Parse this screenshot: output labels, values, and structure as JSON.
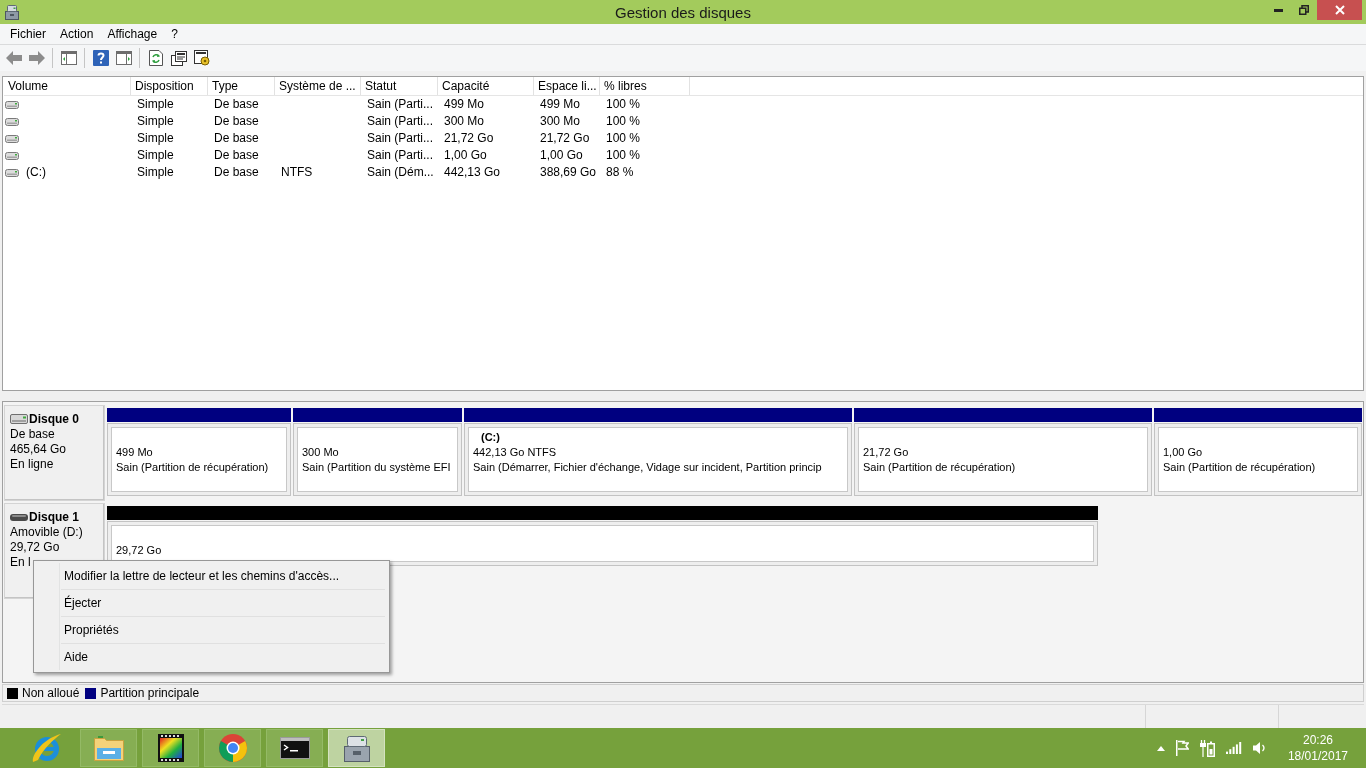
{
  "window": {
    "title": "Gestion des disques"
  },
  "menu_bar": [
    "Fichier",
    "Action",
    "Affichage",
    "?"
  ],
  "table": {
    "columns": [
      "Volume",
      "Disposition",
      "Type",
      "Système de ...",
      "Statut",
      "Capacité",
      "Espace li...",
      "% libres"
    ],
    "rows": [
      {
        "disposition": "Simple",
        "type": "De base",
        "status": "Sain (Parti...",
        "capacity": "499 Mo",
        "column_7": "499 Mo",
        "percent_free": "100 %"
      },
      {
        "disposition": "Simple",
        "type": "De base",
        "status": "Sain (Parti...",
        "capacity": "300 Mo",
        "column_7": "300 Mo",
        "percent_free": "100 %"
      },
      {
        "disposition": "Simple",
        "type": "De base",
        "status": "Sain (Parti...",
        "capacity": "21,72 Go",
        "column_7": "21,72 Go",
        "percent_free": "100 %"
      },
      {
        "disposition": "Simple",
        "type": "De base",
        "status": "Sain (Parti...",
        "capacity": "1,00 Go",
        "column_7": "1,00 Go",
        "percent_free": "100 %"
      },
      {
        "volume": "(C:)",
        "disposition": "Simple",
        "type": "De base",
        "column_4": "NTFS",
        "status": "Sain (Dém...",
        "capacity": "442,13 Go",
        "column_7": "388,69 Go",
        "percent_free": "88 %"
      }
    ]
  },
  "disks": [
    {
      "kind": "fixed",
      "name": "Disque 0",
      "details": [
        "De base",
        "465,64 Go",
        "En ligne"
      ],
      "partitions": [
        {
          "kind": "primary",
          "size": "499 Mo",
          "status": "Sain (Partition de récupération)"
        },
        {
          "kind": "primary",
          "size": "300 Mo",
          "status": "Sain (Partition du système EFI"
        },
        {
          "kind": "primary",
          "label": "(C:)",
          "size": "442,13 Go NTFS",
          "status": "Sain (Démarrer, Fichier d'échange, Vidage sur incident, Partition princip"
        },
        {
          "kind": "primary",
          "size": "21,72 Go",
          "status": "Sain (Partition de récupération)"
        },
        {
          "kind": "primary",
          "size": "1,00 Go",
          "status": "Sain (Partition de récupération)"
        }
      ]
    },
    {
      "kind": "removable",
      "name": "Disque 1",
      "details": [
        "Amovible (D:)",
        "29,72 Go",
        "En l"
      ],
      "partitions": [
        {
          "kind": "unallocated",
          "size": "29,72 Go"
        }
      ]
    }
  ],
  "context_menu": {
    "items": [
      "Modifier la lettre de lecteur et les chemins d'accès...",
      "Éjecter",
      "Propriétés",
      "Aide"
    ]
  },
  "legend": [
    {
      "kind": "unallocated",
      "label": "Non alloué",
      "color": "#000000"
    },
    {
      "kind": "primary",
      "label": "Partition principale",
      "color": "#000080"
    }
  ],
  "taskbar": {
    "apps": [
      {
        "kind": "ebrowser",
        "running": false,
        "selected": false
      },
      {
        "kind": "folder",
        "running": true,
        "selected": false
      },
      {
        "kind": "filmstrip",
        "running": true,
        "selected": false
      },
      {
        "kind": "roundbrowser",
        "running": true,
        "selected": false
      },
      {
        "kind": "terminal",
        "running": true,
        "selected": false
      },
      {
        "kind": "disktool",
        "running": true,
        "selected": true
      }
    ],
    "time": "20:26",
    "date": "18/01/2017"
  }
}
